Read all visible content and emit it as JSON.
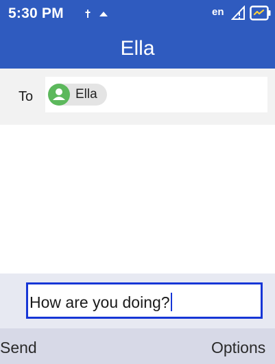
{
  "status_bar": {
    "time": "5:30 PM",
    "language": "en"
  },
  "header": {
    "title": "Ella"
  },
  "recipient": {
    "label": "To",
    "chip_name": "Ella"
  },
  "compose": {
    "text": "How are you doing?"
  },
  "softkeys": {
    "left": "Send",
    "right": "Options"
  },
  "colors": {
    "app_bar": "#2f5bbf",
    "input_border": "#1636d6",
    "avatar": "#5cb85c"
  },
  "icons": [
    "signal-icon",
    "notification-icon",
    "no-signal-icon",
    "battery-charging-icon",
    "person-icon"
  ]
}
